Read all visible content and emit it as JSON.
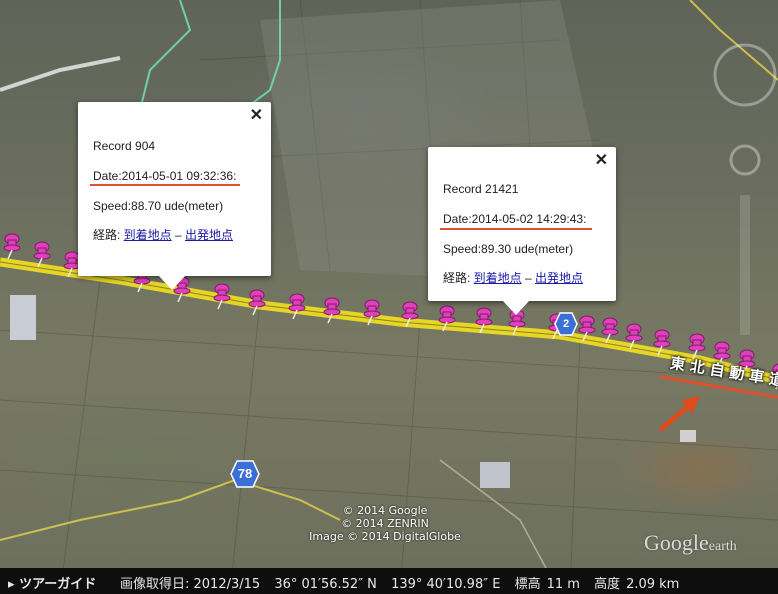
{
  "map": {
    "road_label": "東北自動車道",
    "shields": [
      {
        "number": "78"
      },
      {
        "number": "2"
      }
    ],
    "copyright": [
      "© 2014 Google",
      "© 2014 ZENRIN",
      "Image © 2014 DigitalGlobe"
    ],
    "logo": {
      "main": "Google",
      "sub": "earth"
    },
    "colors": {
      "highway": "#f4e020",
      "pin": "#e23fbd",
      "accent_line": "#e0502a",
      "arrow": "#e04a1c",
      "shield": "#3a6fd8"
    }
  },
  "balloons": [
    {
      "record": "Record 904",
      "date": "Date:2014-05-01 09:32:36:",
      "speed": "Speed:88.70 ude(meter)",
      "route_prefix": "経路: ",
      "arrive_link": "到着地点",
      "separator": " – ",
      "depart_link": "出発地点",
      "close": "✕"
    },
    {
      "record": "Record 21421",
      "date": "Date:2014-05-02 14:29:43:",
      "speed": "Speed:89.30 ude(meter)",
      "route_prefix": "経路: ",
      "arrive_link": "到着地点",
      "separator": " – ",
      "depart_link": "出発地点",
      "close": "✕"
    }
  ],
  "statusbar": {
    "tour_icon": "play-icon",
    "tour_label": "ツアーガイド",
    "imagery_date": "画像取得日: 2012/3/15",
    "latitude": "36° 01′56.52″ N",
    "longitude": "139° 40′10.98″ E",
    "elevation_label": "標高",
    "elevation_value": "11 m",
    "eye_alt_label": "高度",
    "eye_alt_value": "2.09 km"
  }
}
